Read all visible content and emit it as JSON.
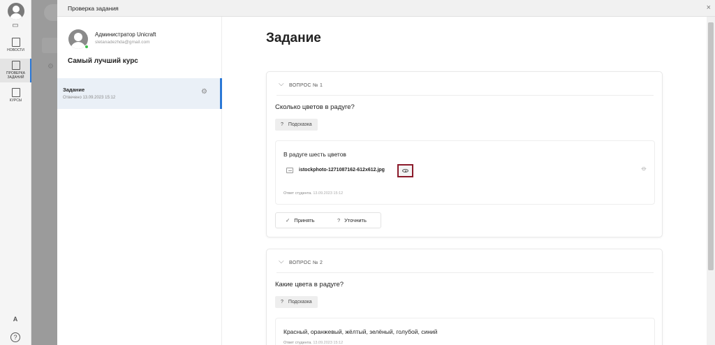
{
  "sidebar": {
    "nav": [
      {
        "label": "НОВОСТИ",
        "icon": "newspaper-icon"
      },
      {
        "label": "ПРОВЕРКА ЗАДАНИЙ",
        "icon": "clipboard-check-icon"
      },
      {
        "label": "КУРСЫ",
        "icon": "book-icon"
      }
    ],
    "help_glyph": "?"
  },
  "modal": {
    "title": "Проверка задания",
    "close_glyph": "×"
  },
  "user": {
    "name": "Администратор Unicraft",
    "email": "sletanadezhda@gmail.com"
  },
  "course": {
    "title": "Самый лучший курс",
    "task": {
      "name": "Задание",
      "date": "Отвечено 13.09.2023 15:12"
    }
  },
  "main": {
    "heading": "Задание",
    "questions": [
      {
        "label": "ВОПРОС № 1",
        "text": "Сколько цветов в радуге?",
        "hint_label": "Подсказка",
        "answer_text": "В радуге шесть цветов",
        "file_name": "istockphoto-1271087162-612x612.jpg",
        "student_label": "Ответ студента.",
        "student_date": "13.09.2023 15:12",
        "accept_label": "Принять",
        "clarify_label": "Уточнить"
      },
      {
        "label": "ВОПРОС № 2",
        "text": "Какие цвета в радуге?",
        "hint_label": "Подсказка",
        "answer_text": "Красный, оранжевый, жёлтый, зелёный, голубой, синий",
        "student_label": "Ответ студента.",
        "student_date": "13.09.2023 15:12"
      }
    ]
  },
  "colors": {
    "accent": "#2b78d6",
    "highlight_border": "#8b1a2a",
    "online": "#3cc04a"
  }
}
